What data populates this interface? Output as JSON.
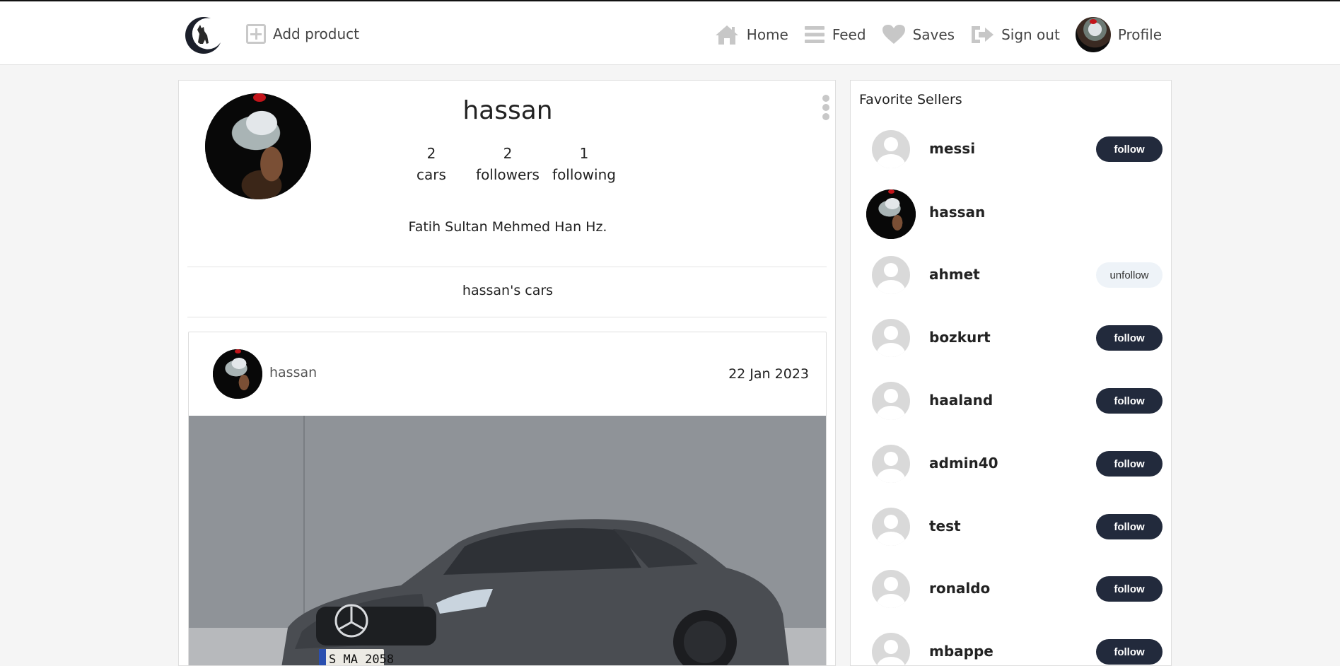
{
  "nav": {
    "add_product": "Add product",
    "items": [
      {
        "label": "Home",
        "icon": "home-icon"
      },
      {
        "label": "Feed",
        "icon": "feed-icon"
      },
      {
        "label": "Saves",
        "icon": "heart-icon"
      },
      {
        "label": "Sign out",
        "icon": "sign-out-icon"
      },
      {
        "label": "Profile",
        "icon": "avatar"
      }
    ]
  },
  "profile": {
    "name": "hassan",
    "stats": [
      {
        "value": "2",
        "label": "cars"
      },
      {
        "value": "2",
        "label": "followers"
      },
      {
        "value": "1",
        "label": "following"
      }
    ],
    "bio": "Fatih Sultan Mehmed Han Hz.",
    "cars_title": "hassan's cars"
  },
  "post": {
    "user": "hassan",
    "date": "22 Jan 2023",
    "plate": "S MA 2058"
  },
  "sidebar": {
    "title": "Favorite Sellers",
    "sellers": [
      {
        "name": "messi",
        "button": "follow"
      },
      {
        "name": "hassan",
        "button": ""
      },
      {
        "name": "ahmet",
        "button": "unfollow"
      },
      {
        "name": "bozkurt",
        "button": "follow"
      },
      {
        "name": "haaland",
        "button": "follow"
      },
      {
        "name": "admin40",
        "button": "follow"
      },
      {
        "name": "test",
        "button": "follow"
      },
      {
        "name": "ronaldo",
        "button": "follow"
      },
      {
        "name": "mbappe",
        "button": "follow"
      }
    ]
  },
  "colors": {
    "accent_button": "#222a3c",
    "unfollow_button": "#eef3f8",
    "background": "#f5f5f5"
  }
}
